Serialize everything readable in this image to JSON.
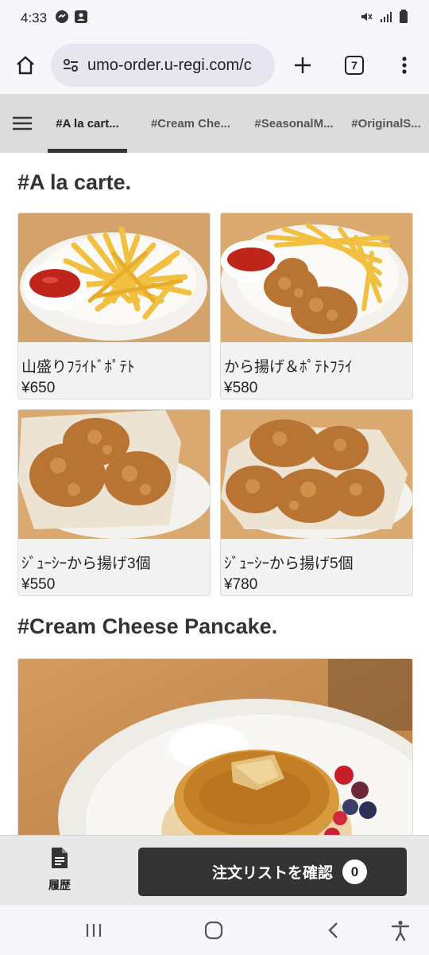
{
  "status": {
    "time": "4:33"
  },
  "browser": {
    "url": "umo-order.u-regi.com/c",
    "tab_count": "7"
  },
  "categories": [
    {
      "label": "#A la cart..."
    },
    {
      "label": "#Cream Che..."
    },
    {
      "label": "#SeasonalM..."
    },
    {
      "label": "#OriginalS..."
    }
  ],
  "sections": [
    {
      "title": "#A la carte.",
      "items": [
        {
          "name": "山盛りﾌﾗｲﾄﾞﾎﾟﾃﾄ",
          "price": "¥650",
          "image": "fries-icon"
        },
        {
          "name": "から揚げ＆ﾎﾟﾃﾄﾌﾗｲ",
          "price": "¥580",
          "image": "karaage-fries-icon"
        },
        {
          "name": "ｼﾞｭｰｼｰから揚げ3個",
          "price": "¥550",
          "image": "karaage-3-icon"
        },
        {
          "name": "ｼﾞｭｰｼｰから揚げ5個",
          "price": "¥780",
          "image": "karaage-5-icon"
        }
      ]
    },
    {
      "title": "#Cream Cheese Pancake.",
      "image": "pancake-icon"
    }
  ],
  "bottom": {
    "history_label": "履歴",
    "order_button": "注文リストを確認",
    "order_count": "0"
  },
  "colors": {
    "bar_bg": "#f6f6fb",
    "cat_bg": "#dcdcdc",
    "button_dark": "#333333",
    "wood": "#d9a970"
  }
}
